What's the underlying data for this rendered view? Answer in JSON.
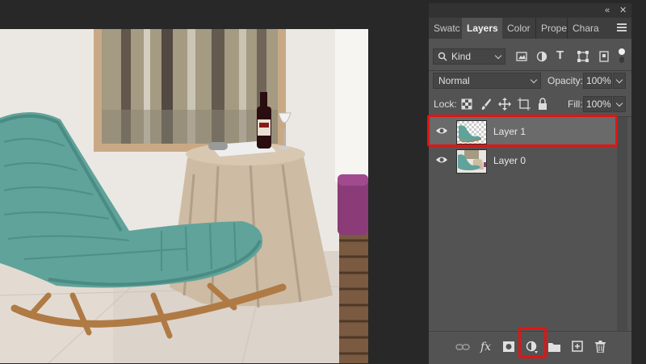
{
  "panel": {
    "topbar_icons": {
      "collapse": "collapse-icon",
      "close": "close-icon"
    },
    "tabs": [
      {
        "label": "Swatc",
        "active": false
      },
      {
        "label": "Layers",
        "active": true
      },
      {
        "label": "Color",
        "active": false
      },
      {
        "label": "Prope",
        "active": false
      },
      {
        "label": "Charac",
        "active": false
      }
    ],
    "filter": {
      "label": "Kind",
      "icons": [
        "image-filter-icon",
        "adjustment-filter-icon",
        "type-filter-icon",
        "shape-filter-icon",
        "smart-object-filter-icon",
        "filter-toggle-icon"
      ]
    },
    "blend_mode": "Normal",
    "opacity_label": "Opacity:",
    "opacity_value": "100%",
    "lock_label": "Lock:",
    "fill_label": "Fill:",
    "fill_value": "100%",
    "layers": [
      {
        "name": "Layer 1",
        "selected": true,
        "visible": true
      },
      {
        "name": "Layer 0",
        "selected": false,
        "visible": true
      }
    ],
    "bottom_icons": [
      "link-layers-icon",
      "fx-icon",
      "layer-mask-icon",
      "new-adjustment-layer-icon",
      "new-group-icon",
      "new-layer-icon",
      "delete-layer-icon"
    ],
    "fx_label": "fx"
  },
  "highlight_color": "#e01515",
  "selected_row_color": "#6a6a6a"
}
